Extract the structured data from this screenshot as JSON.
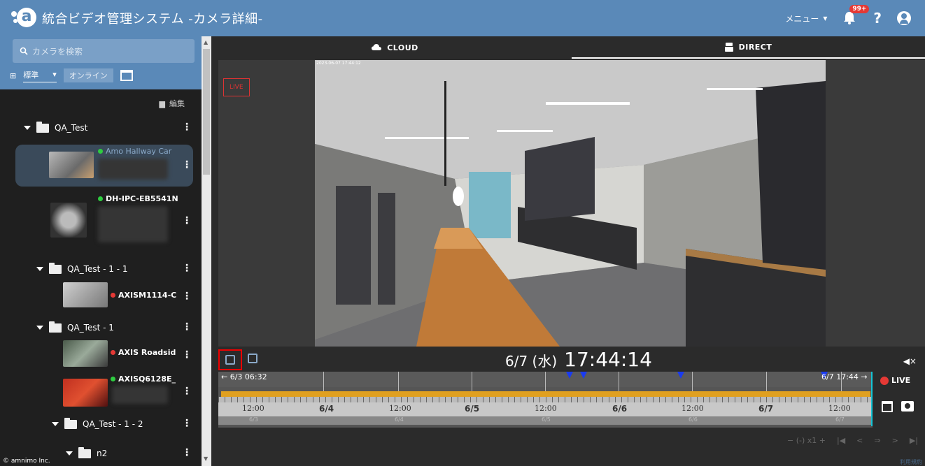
{
  "header": {
    "title": "統合ビデオ管理システム  -カメラ詳細-",
    "menu_label": "メニュー",
    "notification_badge": "99+",
    "help_label": "?"
  },
  "sidebar": {
    "search_placeholder": "カメラを検索",
    "view_select": "標準",
    "online_label": "オンライン",
    "edit_label": "編集",
    "folders": [
      {
        "label": "QA_Test"
      },
      {
        "label": "QA_Test - 1 - 1"
      },
      {
        "label": "QA_Test - 1"
      },
      {
        "label": "QA_Test - 1 - 2"
      },
      {
        "label": "n2"
      }
    ],
    "cameras": [
      {
        "name": "Amo Hallway Car",
        "status": "online"
      },
      {
        "name": "DH-IPC-EB5541N",
        "status": "online"
      },
      {
        "name": "AXISM1114-C",
        "status": "offline"
      },
      {
        "name": "AXIS Roadsid",
        "status": "offline"
      },
      {
        "name": "AXISQ6128E_",
        "status": "online"
      }
    ],
    "copyright": "© amnimo Inc."
  },
  "tabs": [
    {
      "label": "CLOUD",
      "icon": "cloud-icon",
      "active": false
    },
    {
      "label": "DIRECT",
      "icon": "device-icon",
      "active": true
    }
  ],
  "video": {
    "live_badge": "LIVE",
    "overlay_timestamp": "2023-06-07 17:44:12"
  },
  "playback": {
    "date": "6/7 (水)",
    "time": "17:44:14",
    "live_label": "LIVE"
  },
  "timeline": {
    "start_label": "← 6/3 06:32",
    "end_label": "6/7 17:44 →",
    "labels": [
      "12:00",
      "6/4",
      "12:00",
      "6/5",
      "12:00",
      "6/6",
      "12:00",
      "6/7",
      "12:00"
    ],
    "sub_labels": [
      "6/3",
      "6/4",
      "6/5",
      "6/6",
      "6/7"
    ]
  },
  "bottom_controls": {
    "zoom": "− (-) x1 +",
    "nav": [
      "|◀",
      "<",
      "⇒",
      ">",
      "▶|"
    ],
    "footer_link": "利用規約"
  },
  "colors": {
    "header_bg": "#5a89b8",
    "accent_orange": "#e0a020",
    "live_red": "#e53935",
    "online_green": "#2ecc40",
    "offline_red": "#e53935",
    "cursor_cyan": "#15c5d6"
  }
}
